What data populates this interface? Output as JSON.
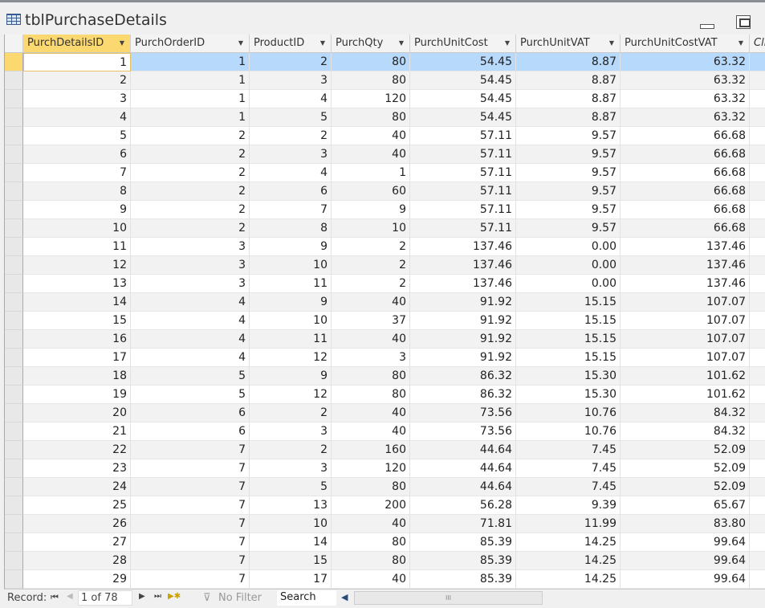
{
  "window": {
    "title": "tblPurchaseDetails"
  },
  "columns": [
    "PurchDetailsID",
    "PurchOrderID",
    "ProductID",
    "PurchQty",
    "PurchUnitCost",
    "PurchUnitVAT",
    "PurchUnitCostVAT",
    "Cli"
  ],
  "rows": [
    [
      "1",
      "1",
      "2",
      "80",
      "54.45",
      "8.87",
      "63.32"
    ],
    [
      "2",
      "1",
      "3",
      "80",
      "54.45",
      "8.87",
      "63.32"
    ],
    [
      "3",
      "1",
      "4",
      "120",
      "54.45",
      "8.87",
      "63.32"
    ],
    [
      "4",
      "1",
      "5",
      "80",
      "54.45",
      "8.87",
      "63.32"
    ],
    [
      "5",
      "2",
      "2",
      "40",
      "57.11",
      "9.57",
      "66.68"
    ],
    [
      "6",
      "2",
      "3",
      "40",
      "57.11",
      "9.57",
      "66.68"
    ],
    [
      "7",
      "2",
      "4",
      "1",
      "57.11",
      "9.57",
      "66.68"
    ],
    [
      "8",
      "2",
      "6",
      "60",
      "57.11",
      "9.57",
      "66.68"
    ],
    [
      "9",
      "2",
      "7",
      "9",
      "57.11",
      "9.57",
      "66.68"
    ],
    [
      "10",
      "2",
      "8",
      "10",
      "57.11",
      "9.57",
      "66.68"
    ],
    [
      "11",
      "3",
      "9",
      "2",
      "137.46",
      "0.00",
      "137.46"
    ],
    [
      "12",
      "3",
      "10",
      "2",
      "137.46",
      "0.00",
      "137.46"
    ],
    [
      "13",
      "3",
      "11",
      "2",
      "137.46",
      "0.00",
      "137.46"
    ],
    [
      "14",
      "4",
      "9",
      "40",
      "91.92",
      "15.15",
      "107.07"
    ],
    [
      "15",
      "4",
      "10",
      "37",
      "91.92",
      "15.15",
      "107.07"
    ],
    [
      "16",
      "4",
      "11",
      "40",
      "91.92",
      "15.15",
      "107.07"
    ],
    [
      "17",
      "4",
      "12",
      "3",
      "91.92",
      "15.15",
      "107.07"
    ],
    [
      "18",
      "5",
      "9",
      "80",
      "86.32",
      "15.30",
      "101.62"
    ],
    [
      "19",
      "5",
      "12",
      "80",
      "86.32",
      "15.30",
      "101.62"
    ],
    [
      "20",
      "6",
      "2",
      "40",
      "73.56",
      "10.76",
      "84.32"
    ],
    [
      "21",
      "6",
      "3",
      "40",
      "73.56",
      "10.76",
      "84.32"
    ],
    [
      "22",
      "7",
      "2",
      "160",
      "44.64",
      "7.45",
      "52.09"
    ],
    [
      "23",
      "7",
      "3",
      "120",
      "44.64",
      "7.45",
      "52.09"
    ],
    [
      "24",
      "7",
      "5",
      "80",
      "44.64",
      "7.45",
      "52.09"
    ],
    [
      "25",
      "7",
      "13",
      "200",
      "56.28",
      "9.39",
      "65.67"
    ],
    [
      "26",
      "7",
      "10",
      "40",
      "71.81",
      "11.99",
      "83.80"
    ],
    [
      "27",
      "7",
      "14",
      "80",
      "85.39",
      "14.25",
      "99.64"
    ],
    [
      "28",
      "7",
      "15",
      "80",
      "85.39",
      "14.25",
      "99.64"
    ],
    [
      "29",
      "7",
      "17",
      "40",
      "85.39",
      "14.25",
      "99.64"
    ]
  ],
  "nav": {
    "record_label": "Record:",
    "position": "1 of 78",
    "filter": "No Filter",
    "search": "Search",
    "scroll_grip": "III"
  },
  "colors": {
    "selected_row": "#b7d9fb",
    "active_header": "#fbd870",
    "alt_row": "#f2f2f2"
  }
}
